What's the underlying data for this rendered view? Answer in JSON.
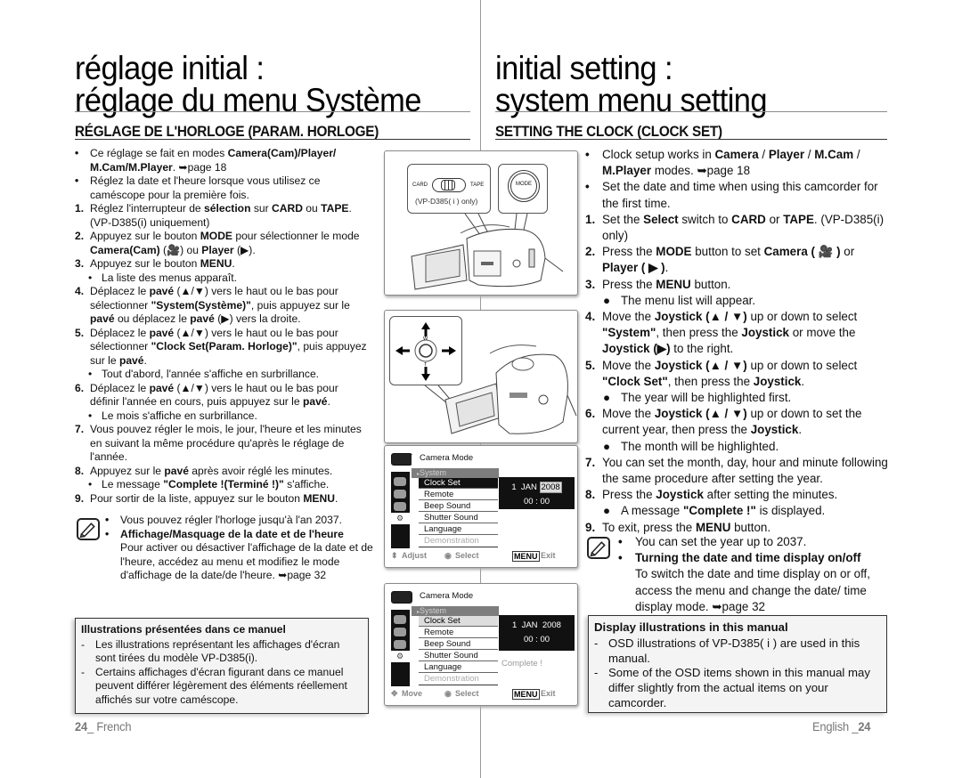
{
  "left": {
    "title_line1": "réglage initial :",
    "title_line2": "réglage du menu Système",
    "subtitle": "RÉGLAGE DE L'HORLOGE (PARAM. HORLOGE)",
    "items": [
      {
        "marker": "•",
        "parts": [
          {
            "t": "Ce réglage se fait en modes "
          },
          {
            "b": "Camera(Cam)/Player/ M.Cam/M.Player"
          },
          {
            "t": ". ➥page 18"
          }
        ]
      },
      {
        "marker": "•",
        "parts": [
          {
            "t": "Réglez la date et l'heure lorsque vous utilisez ce caméscope pour la première fois."
          }
        ]
      },
      {
        "marker": "1.",
        "parts": [
          {
            "t": "Réglez l'interrupteur de "
          },
          {
            "b": "sélection"
          },
          {
            "t": " sur "
          },
          {
            "b": "CARD"
          },
          {
            "t": " ou "
          },
          {
            "b": "TAPE"
          },
          {
            "t": ". (VP-D385(i) uniquement)"
          }
        ]
      },
      {
        "marker": "2.",
        "parts": [
          {
            "t": "Appuyez sur le bouton "
          },
          {
            "b": "MODE"
          },
          {
            "t": " pour sélectionner le mode "
          },
          {
            "b": "Camera(Cam)"
          },
          {
            "t": " (🎥) ou "
          },
          {
            "b": "Player"
          },
          {
            "t": " (▶)."
          }
        ]
      },
      {
        "marker": "3.",
        "parts": [
          {
            "t": "Appuyez sur le bouton "
          },
          {
            "b": "MENU"
          },
          {
            "t": "."
          }
        ]
      },
      {
        "marker": "•",
        "sub": true,
        "parts": [
          {
            "t": "La liste des menus apparaît."
          }
        ]
      },
      {
        "marker": "4.",
        "parts": [
          {
            "t": "Déplacez le "
          },
          {
            "b": "pavé"
          },
          {
            "t": " (▲/▼) vers le haut ou le bas pour sélectionner "
          },
          {
            "b": "\"System(Système)\""
          },
          {
            "t": ", puis appuyez sur le "
          },
          {
            "b": "pavé"
          },
          {
            "t": " ou déplacez le "
          },
          {
            "b": "pavé"
          },
          {
            "t": " (▶) vers la droite."
          }
        ]
      },
      {
        "marker": "5.",
        "parts": [
          {
            "t": "Déplacez le "
          },
          {
            "b": "pavé"
          },
          {
            "t": " (▲/▼) vers le haut ou le bas pour sélectionner "
          },
          {
            "b": "\"Clock Set(Param. Horloge)\""
          },
          {
            "t": ", puis appuyez sur le "
          },
          {
            "b": "pavé"
          },
          {
            "t": "."
          }
        ]
      },
      {
        "marker": "•",
        "sub": true,
        "parts": [
          {
            "t": "Tout d'abord, l'année s'affiche en surbrillance."
          }
        ]
      },
      {
        "marker": "6.",
        "parts": [
          {
            "t": "Déplacez le "
          },
          {
            "b": "pavé"
          },
          {
            "t": " (▲/▼) vers le haut ou le bas pour définir l'année en cours, puis appuyez sur le "
          },
          {
            "b": "pavé"
          },
          {
            "t": "."
          }
        ]
      },
      {
        "marker": "•",
        "sub": true,
        "parts": [
          {
            "t": "Le mois s'affiche en surbrillance."
          }
        ]
      },
      {
        "marker": "7.",
        "parts": [
          {
            "t": "Vous pouvez régler le mois, le jour, l'heure et les minutes en suivant la même procédure qu'après le réglage de l'année."
          }
        ]
      },
      {
        "marker": "8.",
        "parts": [
          {
            "t": "Appuyez sur le "
          },
          {
            "b": "pavé"
          },
          {
            "t": " après avoir réglé les minutes."
          }
        ]
      },
      {
        "marker": "•",
        "sub": true,
        "parts": [
          {
            "t": "Le message "
          },
          {
            "b": "\"Complete !(Terminé !)\""
          },
          {
            "t": " s'affiche."
          }
        ]
      },
      {
        "marker": "9.",
        "parts": [
          {
            "t": "Pour sortir de la liste, appuyez sur le bouton "
          },
          {
            "b": "MENU"
          },
          {
            "t": "."
          }
        ]
      }
    ],
    "note_items": [
      {
        "parts": [
          {
            "t": "Vous pouvez régler l'horloge jusqu'à l'an 2037."
          }
        ]
      },
      {
        "parts": [
          {
            "b": "Affichage/Masquage de la date et de l'heure"
          }
        ]
      }
    ],
    "note_text": "Pour activer ou désactiver l'affichage de la date et de l'heure, accédez au menu et modifiez le mode d'affichage de la date/de l'heure. ➥page 32",
    "infobox": {
      "heading": "Illustrations présentées dans ce manuel",
      "lines": [
        "Les illustrations représentant les affichages d'écran sont tirées du modèle VP-D385(i).",
        "Certains affichages d'écran figurant dans ce manuel peuvent différer légèrement des éléments réellement affichés sur votre caméscope."
      ]
    },
    "footer_page": "24",
    "footer_lang": "_ French"
  },
  "right": {
    "title_line1": "initial setting :",
    "title_line2": "system menu setting",
    "subtitle": "SETTING THE CLOCK (CLOCK SET)",
    "items": [
      {
        "marker": "•",
        "parts": [
          {
            "t": "Clock setup works in "
          },
          {
            "b": "Camera"
          },
          {
            "t": " / "
          },
          {
            "b": "Player"
          },
          {
            "t": " / "
          },
          {
            "b": "M.Cam"
          },
          {
            "t": " / "
          },
          {
            "b": "M.Player"
          },
          {
            "t": " modes. ➥page 18"
          }
        ]
      },
      {
        "marker": "•",
        "parts": [
          {
            "t": "Set the date and time when using this camcorder for the first time."
          }
        ]
      },
      {
        "marker": "1.",
        "parts": [
          {
            "t": "Set the "
          },
          {
            "b": "Select"
          },
          {
            "t": " switch to "
          },
          {
            "b": "CARD"
          },
          {
            "t": " or "
          },
          {
            "b": "TAPE"
          },
          {
            "t": ". (VP-D385(i) only)"
          }
        ]
      },
      {
        "marker": "2.",
        "parts": [
          {
            "t": "Press the "
          },
          {
            "b": "MODE"
          },
          {
            "t": " button to set "
          },
          {
            "b": "Camera ( 🎥 )"
          },
          {
            "t": " or "
          },
          {
            "b": "Player ( ▶ )"
          },
          {
            "t": "."
          }
        ]
      },
      {
        "marker": "3.",
        "parts": [
          {
            "t": "Press the "
          },
          {
            "b": "MENU"
          },
          {
            "t": " button."
          }
        ]
      },
      {
        "marker": "●",
        "sub": true,
        "parts": [
          {
            "t": "The menu list will appear."
          }
        ]
      },
      {
        "marker": "4.",
        "parts": [
          {
            "t": "Move the "
          },
          {
            "b": "Joystick (▲ / ▼)"
          },
          {
            "t": " up or down to select "
          },
          {
            "b": "\"System\""
          },
          {
            "t": ", then press the "
          },
          {
            "b": "Joystick"
          },
          {
            "t": " or move the "
          },
          {
            "b": "Joystick (▶)"
          },
          {
            "t": " to the right."
          }
        ]
      },
      {
        "marker": "5.",
        "parts": [
          {
            "t": "Move the "
          },
          {
            "b": "Joystick (▲ / ▼)"
          },
          {
            "t": " up or down to select "
          },
          {
            "b": "\"Clock Set\""
          },
          {
            "t": ", then press the "
          },
          {
            "b": "Joystick"
          },
          {
            "t": "."
          }
        ]
      },
      {
        "marker": "●",
        "sub": true,
        "parts": [
          {
            "t": "The year will be highlighted first."
          }
        ]
      },
      {
        "marker": "6.",
        "parts": [
          {
            "t": "Move the "
          },
          {
            "b": "Joystick (▲ / ▼)"
          },
          {
            "t": " up or down to set the current year, then press the "
          },
          {
            "b": "Joystick"
          },
          {
            "t": "."
          }
        ]
      },
      {
        "marker": "●",
        "sub": true,
        "parts": [
          {
            "t": "The month will be highlighted."
          }
        ]
      },
      {
        "marker": "7.",
        "parts": [
          {
            "t": "You can set the month, day, hour and minute following the same procedure after setting the year."
          }
        ]
      },
      {
        "marker": "8.",
        "parts": [
          {
            "t": "Press the "
          },
          {
            "b": "Joystick"
          },
          {
            "t": " after setting the minutes."
          }
        ]
      },
      {
        "marker": "●",
        "sub": true,
        "parts": [
          {
            "t": "A message "
          },
          {
            "b": "\"Complete !\""
          },
          {
            "t": " is displayed."
          }
        ]
      },
      {
        "marker": "9.",
        "parts": [
          {
            "t": "To exit, press the "
          },
          {
            "b": "MENU"
          },
          {
            "t": " button."
          }
        ]
      }
    ],
    "note_items": [
      {
        "parts": [
          {
            "t": "You can set the year up to 2037."
          }
        ]
      },
      {
        "parts": [
          {
            "b": "Turning the date and time display on/off"
          }
        ]
      }
    ],
    "note_text": "To switch the date and time display on or off, access the menu and change the date/ time display mode. ➥page 32",
    "infobox": {
      "heading": "Display illustrations in this manual",
      "lines": [
        "OSD illustrations of VP-D385( i ) are used in this manual.",
        "Some of the OSD items shown in this manual may differ slightly from the actual items on your camcorder."
      ]
    },
    "footer_lang": "English _",
    "footer_page": "24"
  },
  "figures": {
    "switch": {
      "card": "CARD",
      "tape": "TAPE",
      "model_note": "(VP-D385( i ) only)",
      "mode": "MODE"
    },
    "joystick": {
      "w": "W",
      "t": "T"
    },
    "osd1": {
      "header": "Camera Mode",
      "category": "System",
      "rows": [
        "Clock Set",
        "Remote",
        "Beep Sound",
        "Shutter Sound",
        "Language",
        "Demonstration"
      ],
      "day": "1",
      "month": "JAN",
      "year": "2008",
      "time": "00 : 00",
      "foot_left": "Adjust",
      "foot_mid": "Select",
      "foot_menu": "MENU",
      "foot_exit": "Exit"
    },
    "osd2": {
      "header": "Camera Mode",
      "category": "System",
      "rows": [
        "Clock Set",
        "Remote",
        "Beep Sound",
        "Shutter Sound",
        "Language",
        "Demonstration"
      ],
      "day": "1",
      "month": "JAN",
      "year": "2008",
      "time": "00 : 00",
      "complete": "Complete !",
      "foot_left": "Move",
      "foot_mid": "Select",
      "foot_menu": "MENU",
      "foot_exit": "Exit"
    }
  }
}
